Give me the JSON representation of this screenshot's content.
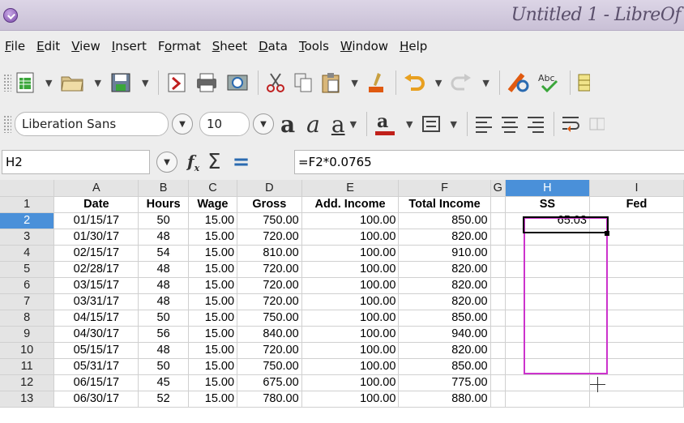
{
  "window": {
    "title": "Untitled 1 - LibreOf"
  },
  "menu": [
    "File",
    "Edit",
    "View",
    "Insert",
    "Format",
    "Sheet",
    "Data",
    "Tools",
    "Window",
    "Help"
  ],
  "menu_underline": [
    "F",
    "E",
    "V",
    "I",
    "o",
    "S",
    "D",
    "T",
    "W",
    "H"
  ],
  "font_toolbar": {
    "font_name": "Liberation Sans",
    "font_size": "10"
  },
  "formula_bar": {
    "cell_ref": "H2",
    "formula": "=F2*0.0765"
  },
  "columns": [
    "A",
    "B",
    "C",
    "D",
    "E",
    "F",
    "G",
    "H",
    "I"
  ],
  "header_row": [
    "Date",
    "Hours",
    "Wage",
    "Gross",
    "Add. Income",
    "Total Income",
    "",
    "SS",
    "Fed"
  ],
  "rows": [
    {
      "n": "2",
      "date": "01/15/17",
      "hours": "50",
      "wage": "15.00",
      "gross": "750.00",
      "add": "100.00",
      "total": "850.00",
      "ss": "65.03"
    },
    {
      "n": "3",
      "date": "01/30/17",
      "hours": "48",
      "wage": "15.00",
      "gross": "720.00",
      "add": "100.00",
      "total": "820.00",
      "ss": ""
    },
    {
      "n": "4",
      "date": "02/15/17",
      "hours": "54",
      "wage": "15.00",
      "gross": "810.00",
      "add": "100.00",
      "total": "910.00",
      "ss": ""
    },
    {
      "n": "5",
      "date": "02/28/17",
      "hours": "48",
      "wage": "15.00",
      "gross": "720.00",
      "add": "100.00",
      "total": "820.00",
      "ss": ""
    },
    {
      "n": "6",
      "date": "03/15/17",
      "hours": "48",
      "wage": "15.00",
      "gross": "720.00",
      "add": "100.00",
      "total": "820.00",
      "ss": ""
    },
    {
      "n": "7",
      "date": "03/31/17",
      "hours": "48",
      "wage": "15.00",
      "gross": "720.00",
      "add": "100.00",
      "total": "820.00",
      "ss": ""
    },
    {
      "n": "8",
      "date": "04/15/17",
      "hours": "50",
      "wage": "15.00",
      "gross": "750.00",
      "add": "100.00",
      "total": "850.00",
      "ss": ""
    },
    {
      "n": "9",
      "date": "04/30/17",
      "hours": "56",
      "wage": "15.00",
      "gross": "840.00",
      "add": "100.00",
      "total": "940.00",
      "ss": ""
    },
    {
      "n": "10",
      "date": "05/15/17",
      "hours": "48",
      "wage": "15.00",
      "gross": "720.00",
      "add": "100.00",
      "total": "820.00",
      "ss": ""
    },
    {
      "n": "11",
      "date": "05/31/17",
      "hours": "50",
      "wage": "15.00",
      "gross": "750.00",
      "add": "100.00",
      "total": "850.00",
      "ss": ""
    },
    {
      "n": "12",
      "date": "06/15/17",
      "hours": "45",
      "wage": "15.00",
      "gross": "675.00",
      "add": "100.00",
      "total": "775.00",
      "ss": ""
    },
    {
      "n": "13",
      "date": "06/30/17",
      "hours": "52",
      "wage": "15.00",
      "gross": "780.00",
      "add": "100.00",
      "total": "880.00",
      "ss": ""
    }
  ],
  "colors": {
    "selection": "#cc33cc",
    "active_header": "#4a90d9"
  }
}
